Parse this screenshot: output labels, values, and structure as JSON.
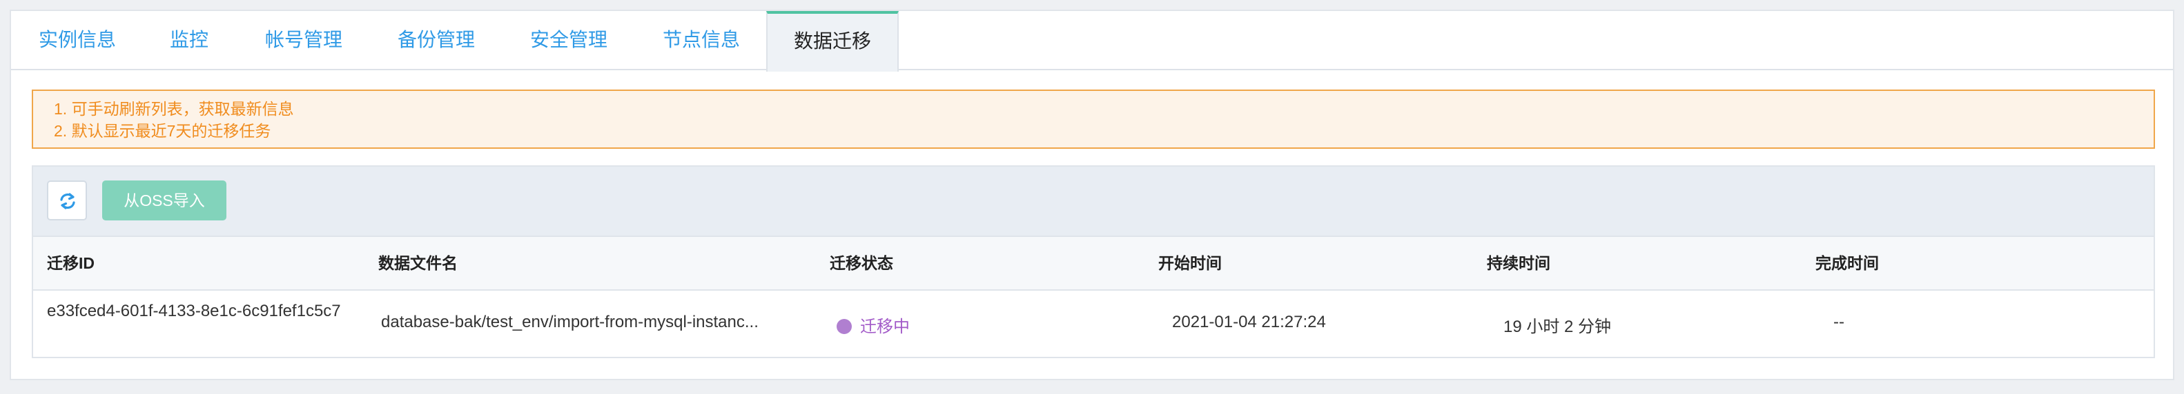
{
  "tabs": [
    {
      "label": "实例信息"
    },
    {
      "label": "监控"
    },
    {
      "label": "帐号管理"
    },
    {
      "label": "备份管理"
    },
    {
      "label": "安全管理"
    },
    {
      "label": "节点信息"
    },
    {
      "label": "数据迁移",
      "active": true
    }
  ],
  "notice": {
    "lines": [
      "1. 可手动刷新列表，获取最新信息",
      "2. 默认显示最近7天的迁移任务"
    ]
  },
  "toolbar": {
    "refresh_icon": "refresh-icon",
    "import_label": "从OSS导入"
  },
  "table": {
    "headers": [
      "迁移ID",
      "数据文件名",
      "迁移状态",
      "开始时间",
      "持续时间",
      "完成时间"
    ],
    "rows": [
      {
        "id": "e33fced4-601f-4133-8e1c-6c91fef1c5c7",
        "file": "database-bak/test_env/import-from-mysql-instanc...",
        "status": "迁移中",
        "start": "2021-01-04 21:27:24",
        "duration": "19 小时 2 分钟",
        "finish": "--"
      }
    ]
  },
  "colors": {
    "tab_link": "#2f9ae6",
    "active_tab_accent": "#4fc3a1",
    "notice_text": "#f08c1e",
    "notice_border": "#f0a64a",
    "import_button": "#82d3bb",
    "status_migrating": "#a25ac8"
  }
}
